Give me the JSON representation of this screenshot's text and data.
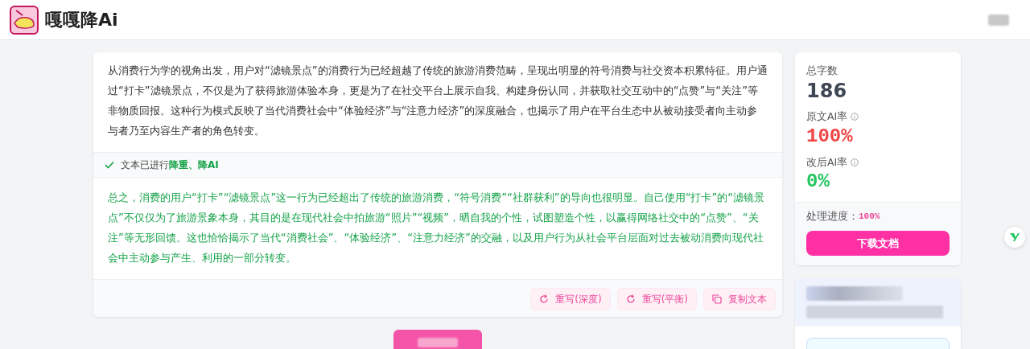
{
  "header": {
    "logo_text": "嘎嘎降Ai"
  },
  "original_text": "从消费行为学的视角出发，用户对“滤镜景点”的消费行为已经超越了传统的旅游消费范畴，呈现出明显的符号消费与社交资本积累特征。用户通过“打卡”滤镜景点，不仅是为了获得旅游体验本身，更是为了在社交平台上展示自我、构建身份认同，并获取社交互动中的“点赞”与“关注”等非物质回报。这种行为模式反映了当代消费社会中“体验经济”与“注意力经济”的深度融合，也揭示了用户在平台生态中从被动接受者向主动参与者乃至内容生产者的角色转变。",
  "status": {
    "text": "文本已进行**降重、降AI**",
    "done": true
  },
  "rewritten_text": "总之，消费的用户“打卡”“滤镜景点”这一行为已经超出了传统的旅游消费，“符号消费”“社群获利”的导向也很明显。自己使用“打卡”的“滤镜景点”不仅仅为了旅游景象本身，其目的是在现代社会中拍旅游“照片”“视频”，晒自我的个性，试图塑造个性，以赢得网络社交中的“点赞”、“关注”等无形回馈。这也恰恰揭示了当代“消费社会”、“体验经济”、“注意力经济”的交融，以及用户行为从社会平台层面对过去被动消费向现代社会中主动参与产生、利用的一部分转变。",
  "actions": [
    {
      "label": "重写(深度)"
    },
    {
      "label": "重写(平衡)"
    },
    {
      "label": "复制文本"
    }
  ],
  "stats": [
    {
      "label": "总字数",
      "value": "186",
      "kind": "count",
      "info": false
    },
    {
      "label": "原文AI率",
      "value": "100%",
      "kind": "bad",
      "info": true
    },
    {
      "label": "改后AI率",
      "value": "0%",
      "kind": "good",
      "info": true
    }
  ],
  "progress": {
    "label": "处理进度：",
    "value": "100%"
  },
  "download_button": "下载文档"
}
